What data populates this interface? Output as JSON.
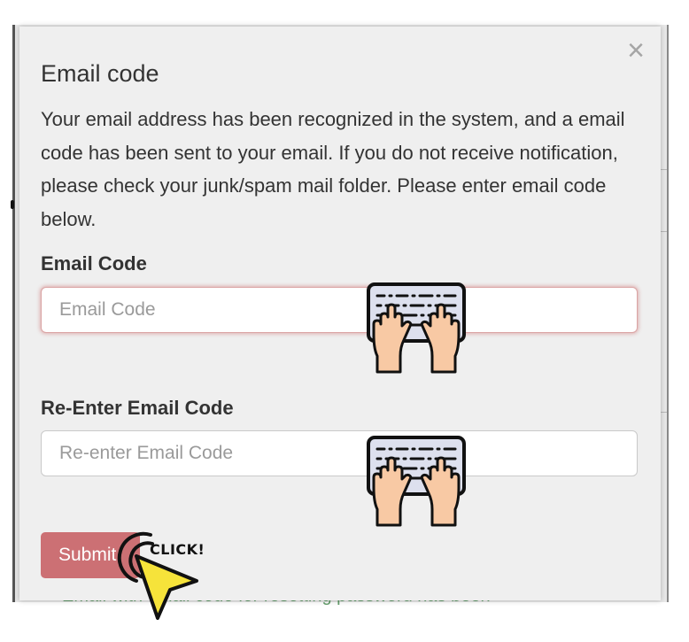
{
  "background": {
    "footer_text": "Email with email code for resetting password has been"
  },
  "modal": {
    "close_glyph": "×",
    "title": "Email code",
    "message": "Your email address has been recognized in the system, and a email code has been sent to your email. If you do not receive notification, please check your junk/spam mail folder. Please enter email code below.",
    "email_code": {
      "label": "Email Code",
      "placeholder": "Email Code",
      "value": "",
      "state": "error"
    },
    "reenter_code": {
      "label": "Re-Enter Email Code",
      "placeholder": "Re-enter Email Code",
      "value": ""
    },
    "submit_label": "Submit"
  },
  "overlays": {
    "typing_icon": "keyboard-typing-hands-icon",
    "cursor_icon": "click-cursor-icon",
    "click_text": "CLICK!"
  },
  "colors": {
    "modal_bg": "#efefef",
    "submit_bg": "#cc7074",
    "error_glow": "#dba5a5",
    "cursor_yellow": "#f6e33a",
    "skin": "#f8c9a4",
    "keyboard": "#dde0ee"
  }
}
